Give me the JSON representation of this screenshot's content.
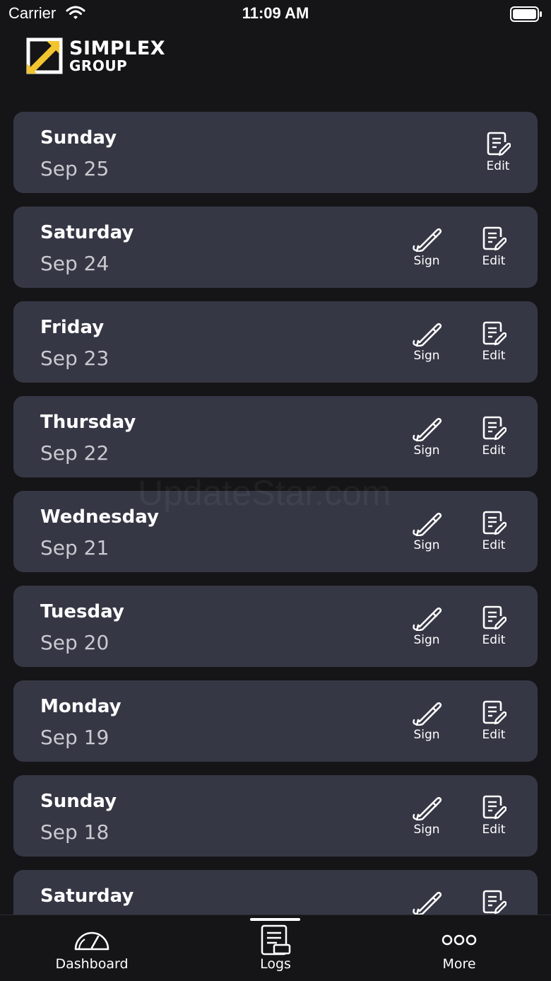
{
  "status_bar": {
    "carrier": "Carrier",
    "time": "11:09 AM"
  },
  "logo": {
    "line1": "SIMPLEX",
    "line2": "GROUP"
  },
  "watermark": "UpdateStar.com",
  "logs": [
    {
      "day": "Sunday",
      "date": "Sep 25",
      "sign": false
    },
    {
      "day": "Saturday",
      "date": "Sep 24",
      "sign": true
    },
    {
      "day": "Friday",
      "date": "Sep 23",
      "sign": true
    },
    {
      "day": "Thursday",
      "date": "Sep 22",
      "sign": true
    },
    {
      "day": "Wednesday",
      "date": "Sep 21",
      "sign": true
    },
    {
      "day": "Tuesday",
      "date": "Sep 20",
      "sign": true
    },
    {
      "day": "Monday",
      "date": "Sep 19",
      "sign": true
    },
    {
      "day": "Sunday",
      "date": "Sep 18",
      "sign": true
    },
    {
      "day": "Saturday",
      "date": "",
      "sign": true
    }
  ],
  "actions": {
    "sign_label": "Sign",
    "edit_label": "Edit"
  },
  "tab_bar": {
    "selected": "Logs",
    "tabs": [
      {
        "label": "Dashboard",
        "icon": "speedometer-icon"
      },
      {
        "label": "Logs",
        "icon": "logs-icon"
      },
      {
        "label": "More",
        "icon": "more-dots-icon"
      }
    ]
  },
  "colors": {
    "background": "#151517",
    "card": "#363745",
    "text": "#ffffff",
    "subtext": "#c9c9cf",
    "logo_accent": "#f2c530"
  }
}
